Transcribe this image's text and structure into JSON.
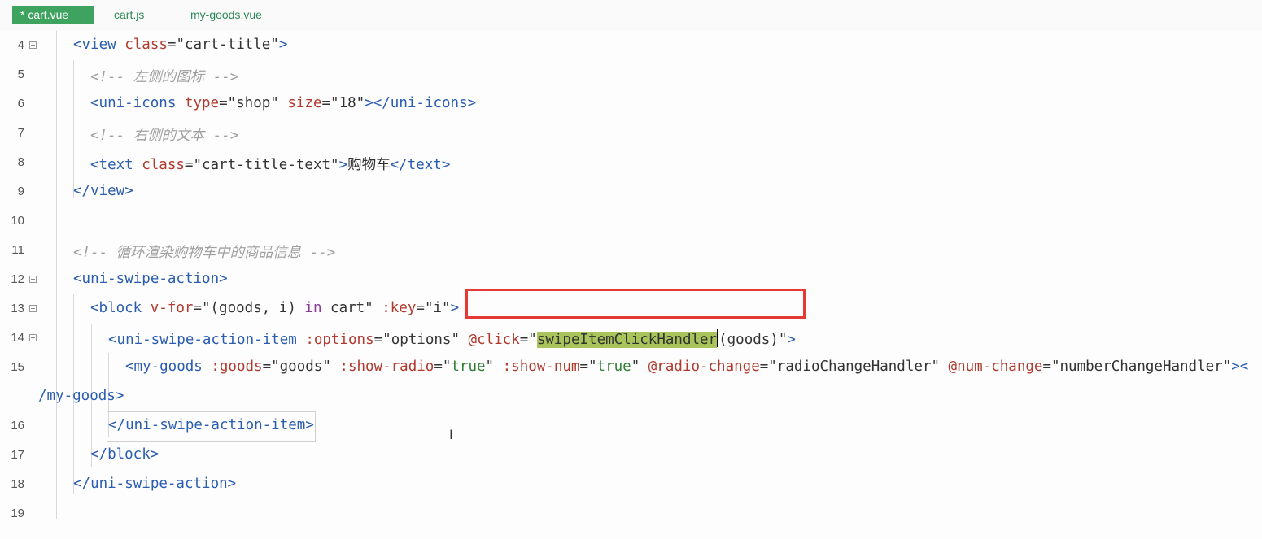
{
  "tabs": [
    {
      "label": "* cart.vue",
      "active": true
    },
    {
      "label": "cart.js",
      "active": false
    },
    {
      "label": "my-goods.vue",
      "active": false
    }
  ],
  "lines": [
    {
      "num": "4"
    },
    {
      "num": "5"
    },
    {
      "num": "6"
    },
    {
      "num": "7"
    },
    {
      "num": "8"
    },
    {
      "num": "9"
    },
    {
      "num": "10"
    },
    {
      "num": "11"
    },
    {
      "num": "12"
    },
    {
      "num": "13"
    },
    {
      "num": "14"
    },
    {
      "num": "15"
    },
    {
      "num": "16"
    },
    {
      "num": "17"
    },
    {
      "num": "18"
    },
    {
      "num": "19"
    }
  ],
  "code": {
    "l4": [
      "<view ",
      "class",
      "=\"cart-title\"",
      ">"
    ],
    "l5": "<!-- 左侧的图标 -->",
    "l6": [
      "<uni-icons ",
      "type",
      "=\"shop\" ",
      "size",
      "=\"18\"",
      "></uni-icons>"
    ],
    "l7": "<!-- 右侧的文本 -->",
    "l8": [
      "<text ",
      "class",
      "=\"cart-title-text\"",
      ">",
      "购物车",
      "</text>"
    ],
    "l9": "</view>",
    "l11": "<!-- 循环渲染购物车中的商品信息 -->",
    "l12": "<uni-swipe-action>",
    "l13": [
      "<block ",
      "v-for",
      "=\"(goods, i) ",
      "in",
      " cart\" ",
      ":key",
      "=\"i\"",
      ">"
    ],
    "l14": [
      "<uni-swipe-action-item ",
      ":options",
      "=\"options\" ",
      "@click",
      "=\"",
      "swipeItemClickHandler",
      "(goods)\"",
      ">"
    ],
    "l15": [
      "<my-goods ",
      ":goods",
      "=\"goods\" ",
      ":show-radio",
      "=\"",
      "true",
      "\" ",
      ":show-num",
      "=\"",
      "true",
      "\" ",
      "@radio-change",
      "=\"radioChangeHandler\" ",
      "@num-change",
      "=\"numberChangeHandler\"",
      "><"
    ],
    "l15wrap": "/my-goods>",
    "l16": "</uni-swipe-action-item>",
    "l17": "</block>",
    "l18": "</uni-swipe-action>"
  }
}
